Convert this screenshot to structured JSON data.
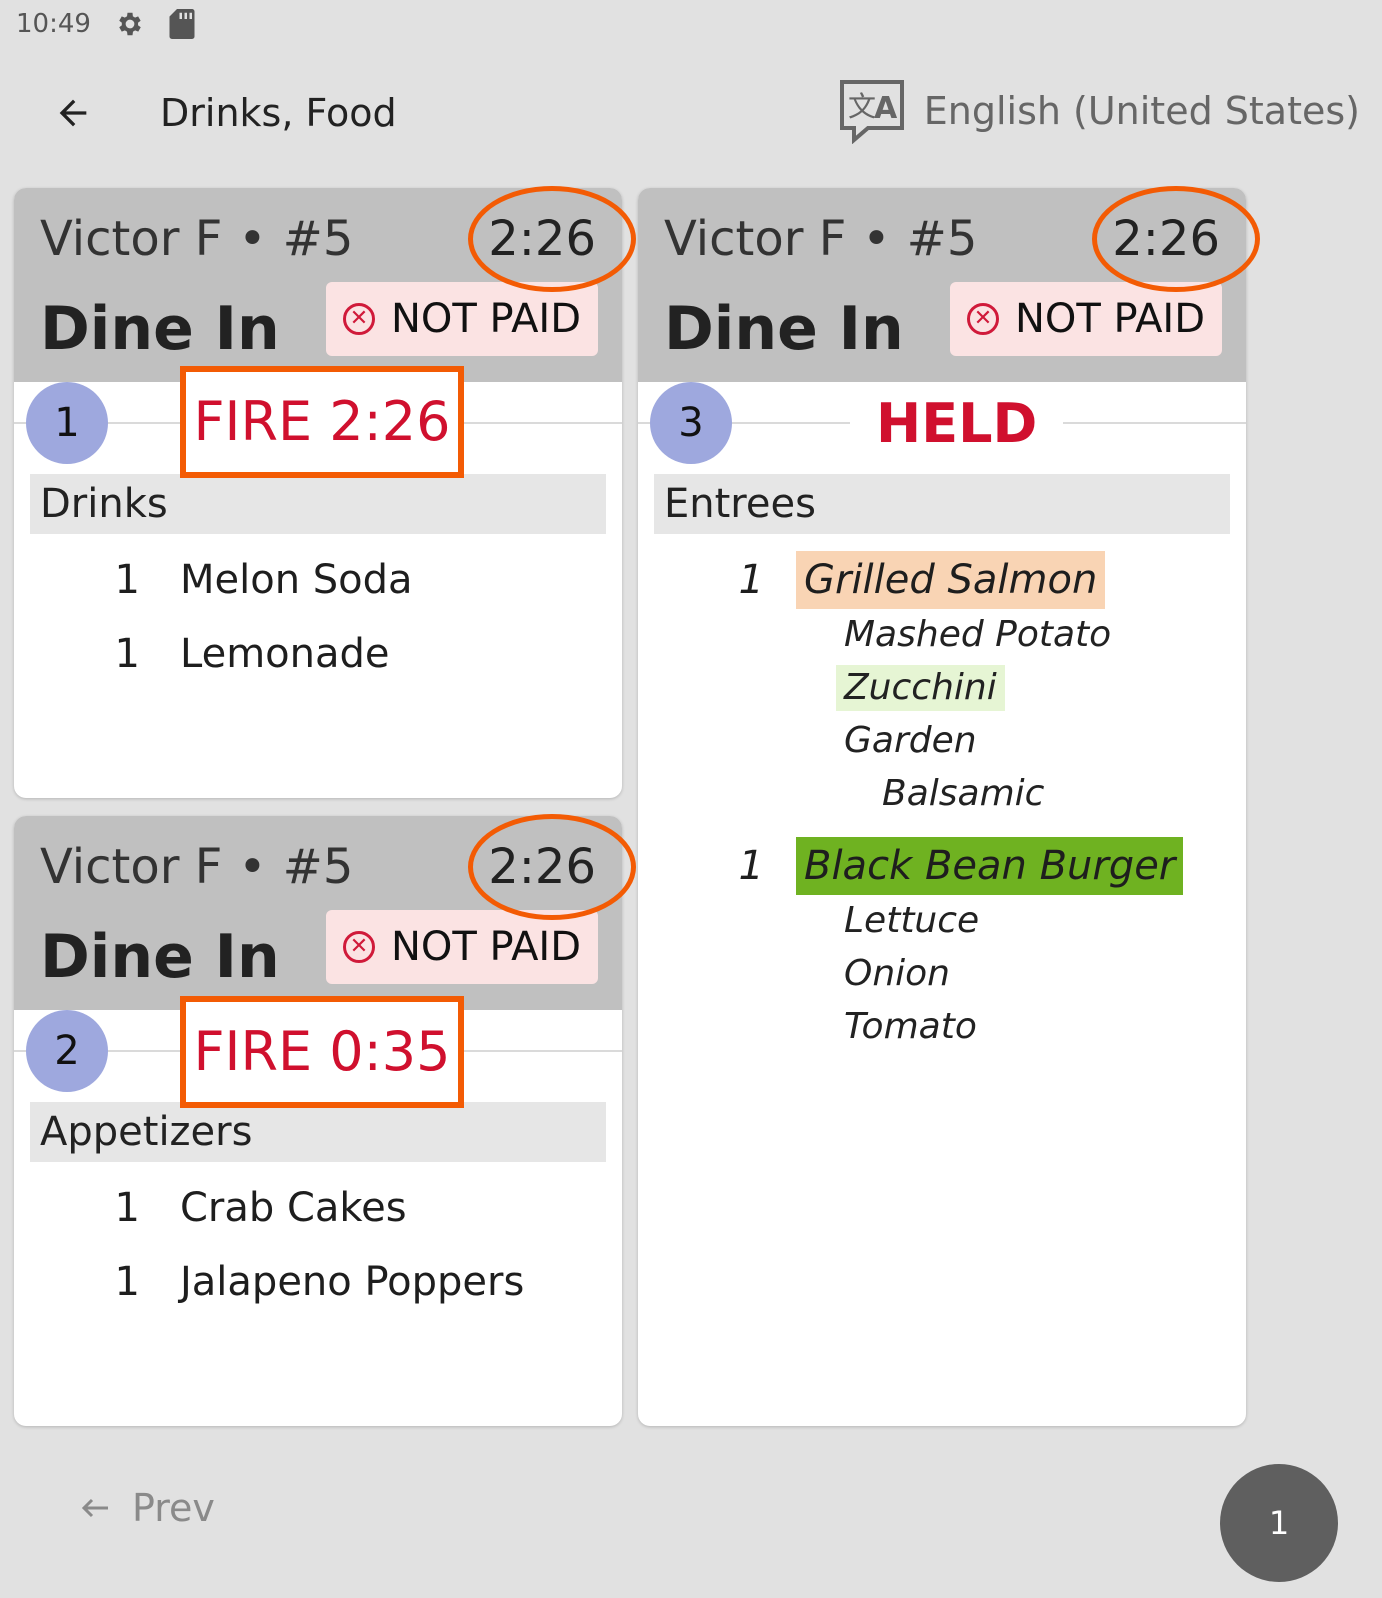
{
  "status_bar": {
    "time": "10:49"
  },
  "app_bar": {
    "title": "Drinks, Food",
    "language": "English (United States)"
  },
  "tickets": [
    {
      "server": "Victor F",
      "separator": "•",
      "table": "#5",
      "timer": "2:26",
      "order_type": "Dine In",
      "payment": "NOT PAID",
      "seat": "1",
      "status": "FIRE 2:26",
      "section": "Drinks",
      "items": [
        {
          "qty": "1",
          "name": "Melon Soda"
        },
        {
          "qty": "1",
          "name": "Lemonade"
        }
      ]
    },
    {
      "server": "Victor F",
      "separator": "•",
      "table": "#5",
      "timer": "2:26",
      "order_type": "Dine In",
      "payment": "NOT PAID",
      "seat": "2",
      "status": "FIRE 0:35",
      "section": "Appetizers",
      "items": [
        {
          "qty": "1",
          "name": "Crab Cakes"
        },
        {
          "qty": "1",
          "name": "Jalapeno Poppers"
        }
      ]
    },
    {
      "server": "Victor F",
      "separator": "•",
      "table": "#5",
      "timer": "2:26",
      "order_type": "Dine In",
      "payment": "NOT PAID",
      "seat": "3",
      "status": "HELD",
      "section": "Entrees",
      "items": [
        {
          "qty": "1",
          "name": "Grilled Salmon",
          "highlight": "#f9d4b4",
          "modifiers": [
            "Mashed Potato",
            "Zucchini",
            "Garden",
            "Balsamic"
          ]
        },
        {
          "qty": "1",
          "name": "Black Bean Burger",
          "highlight": "#6fb221",
          "modifiers": [
            "Lettuce",
            "Onion",
            "Tomato"
          ]
        }
      ]
    }
  ],
  "colors": {
    "accent_orange": "#f35b04",
    "status_red": "#d0102e",
    "seat_circle": "#9ea8de",
    "zucchini_highlight": "#e6f5d4"
  },
  "pager": {
    "prev_label": "Prev",
    "page": "1"
  }
}
